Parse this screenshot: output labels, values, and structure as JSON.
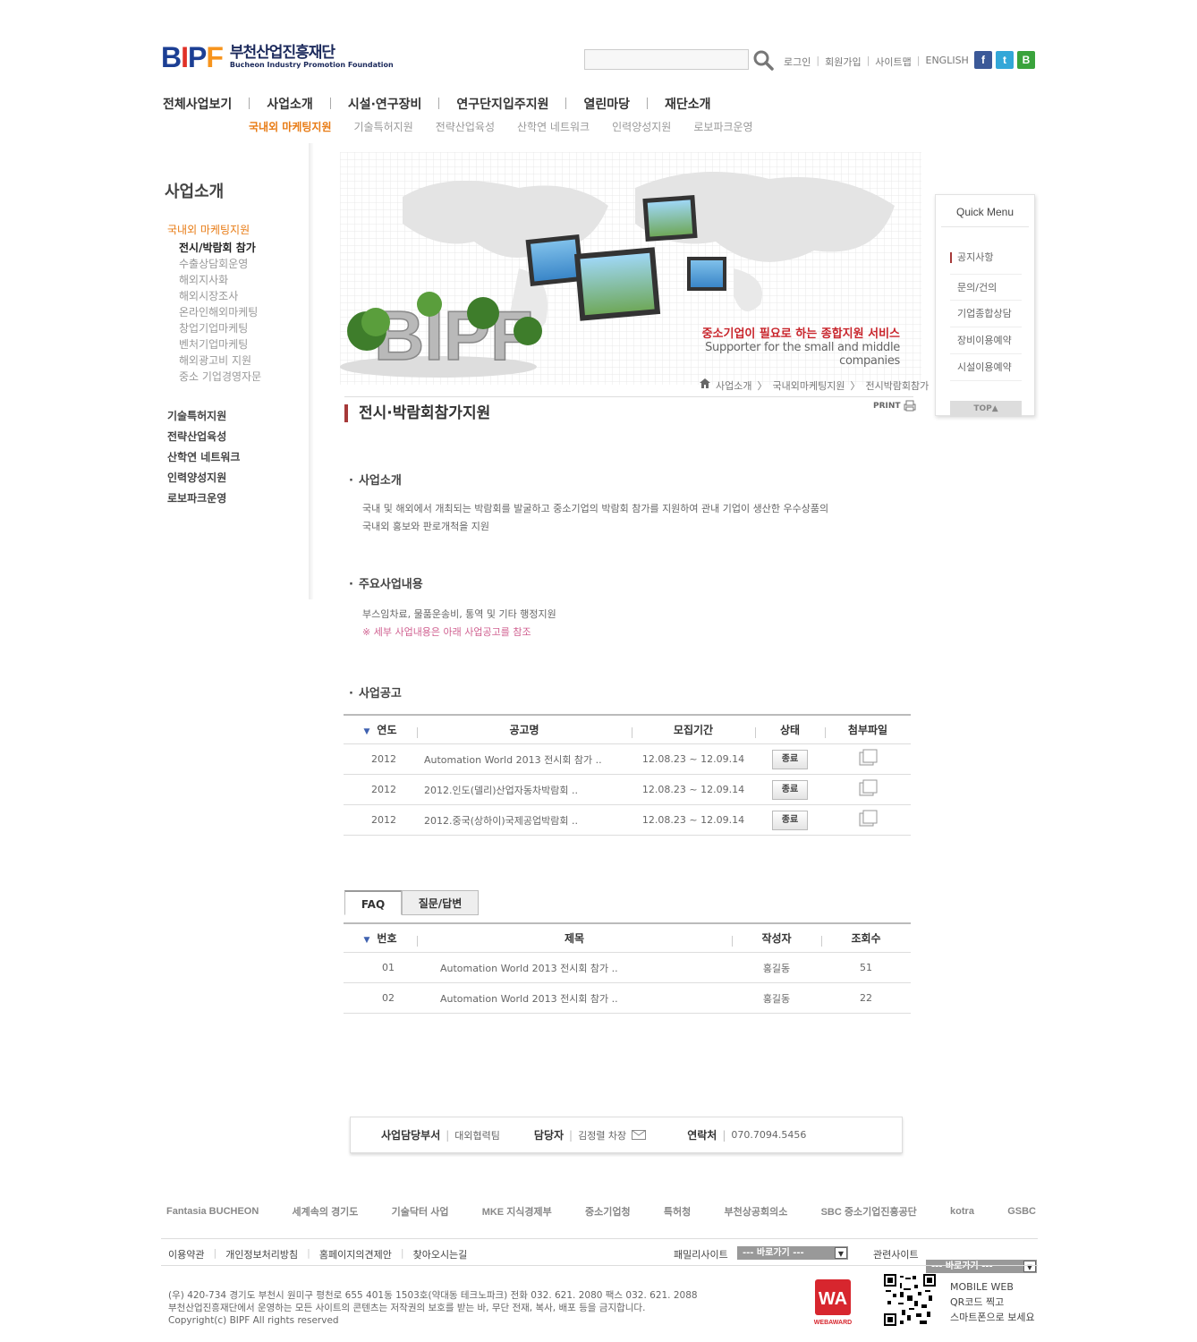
{
  "header": {
    "logo_mark": "BIPF",
    "logo_ko": "부천산업진흥재단",
    "logo_en": "Bucheon Industry Promotion Foundation",
    "search_placeholder": "",
    "util_links": [
      "로그인",
      "회원가입",
      "사이트맵",
      "ENGLISH"
    ],
    "sns": [
      {
        "icon": "facebook-icon",
        "glyph": "f",
        "color": "#3b5998"
      },
      {
        "icon": "twitter-icon",
        "glyph": "t",
        "color": "#33a7d8"
      },
      {
        "icon": "blog-icon",
        "glyph": "B",
        "color": "#3aa33c"
      }
    ]
  },
  "gnb": [
    "전체사업보기",
    "사업소개",
    "시설·연구장비",
    "연구단지입주지원",
    "열린마당",
    "재단소개"
  ],
  "sub_gnb": [
    "국내외 마케팅지원",
    "기술특허지원",
    "전략산업육성",
    "산학연 네트워크",
    "인력양성지원",
    "로보파크운영"
  ],
  "left_menu": {
    "title": "사업소개",
    "active": "국내외 마케팅지원",
    "sub_items": [
      "전시/박람회 참가",
      "수출상담회운영",
      "해외지사화",
      "해외시장조사",
      "온라인해외마케팅",
      "창업기업마케팅",
      "벤처기업마케팅",
      "해외광고비 지원",
      "중소 기업경영자문"
    ],
    "items": [
      "기술특허지원",
      "전략산업육성",
      "산학연 네트워크",
      "인력양성지원",
      "로보파크운영"
    ]
  },
  "visual": {
    "logo": "BIPF",
    "slogan_ko": "중소기업이 필요로 하는 종합지원 서비스",
    "slogan_en": "Supporter for the small and middle companies"
  },
  "breadcrumb": [
    "사업소개",
    "국내외마케팅지원",
    "전시박람회참가"
  ],
  "page_title": "전시·박람회참가지원",
  "print_label": "PRINT",
  "sections": {
    "intro_title": "사업소개",
    "intro_text_1": "국내 및 해외에서 개최되는 박람회를 발굴하고 중소기업의 박람회 참가를 지원하여 관내 기업이 생산한 우수상품의",
    "intro_text_2": "국내외 홍보와 판로개척을 지원",
    "main_title": "주요사업내용",
    "main_text": "부스임차료, 물품운송비, 통역 및 기타 행정지원",
    "main_note": "※ 세부 사업내용은 아래 사업공고를 참조",
    "notice_title": "사업공고"
  },
  "notice_table": {
    "headers": [
      "연도",
      "공고명",
      "모집기간",
      "상태",
      "첨부파일"
    ],
    "rows": [
      {
        "year": "2012",
        "title": "Automation World 2013 전시회 참가 ..",
        "period": "12.08.23 ~ 12.09.14",
        "status": "종료"
      },
      {
        "year": "2012",
        "title": "2012.인도(델리)산업자동차박람회  ..",
        "period": "12.08.23 ~ 12.09.14",
        "status": "종료"
      },
      {
        "year": "2012",
        "title": "2012.중국(상하이)국제공업박람회 ..",
        "period": "12.08.23 ~ 12.09.14",
        "status": "종료"
      }
    ]
  },
  "tabs": [
    "FAQ",
    "질문/답변"
  ],
  "faq_table": {
    "headers": [
      "번호",
      "제목",
      "작성자",
      "조회수"
    ],
    "rows": [
      {
        "no": "01",
        "title": "Automation World 2013 전시회 참가 ..",
        "author": "홍길동",
        "views": "51"
      },
      {
        "no": "02",
        "title": "Automation World 2013 전시회 참가 ..",
        "author": "홍길동",
        "views": "22"
      }
    ]
  },
  "quick_menu": {
    "title": "Quick Menu",
    "items": [
      "공지사항",
      "문의/건의",
      "기업종합상담",
      "장비이용예약",
      "시설이용예약"
    ],
    "top": "TOP▲"
  },
  "contact": {
    "dept_label": "사업담당부서",
    "dept": "대외협력팀",
    "manager_label": "담당자",
    "manager": "김정렬 차장",
    "phone_label": "연락처",
    "phone": "070.7094.5456"
  },
  "partners": [
    "Fantasia BUCHEON",
    "세계속의 경기도",
    "기술닥터 사업",
    "MKE 지식경제부",
    "중소기업청",
    "특허청",
    "부천상공회의소",
    "SBC 중소기업진흥공단",
    "kotra",
    "GSBC"
  ],
  "footer": {
    "links": [
      "이용약관",
      "개인정보처리방침",
      "홈페이지의견제안",
      "찾아오시는길"
    ],
    "family_label": "패밀리사이트",
    "family_select": "--- 바로가기 ---",
    "related_label": "관련사이트",
    "related_select": "--- 바로가기 ---",
    "address_1": "(우) 420-734 경기도 부천시 원미구 평천로 655 401동 1503호(약대동 테크노파크)   전화 032. 621. 2080   팩스 032. 621. 2088",
    "address_2": "부천산업진흥재단에서 운영하는 모든 사이트의 콘텐츠는 저작권의 보호를 받는 바, 무단 전재, 복사, 배포 등을 금지합니다.",
    "copyright": "Copyright(c) BIPF All rights reserved",
    "webaward": "WEBAWARD",
    "mobile_1": "MOBILE WEB",
    "mobile_2": "QR코드 찍고",
    "mobile_3": "스마트폰으로 보세요"
  },
  "colors": {
    "brand_blue": "#1c3f94",
    "accent_orange": "#e87b14",
    "accent_red": "#c8242b"
  }
}
